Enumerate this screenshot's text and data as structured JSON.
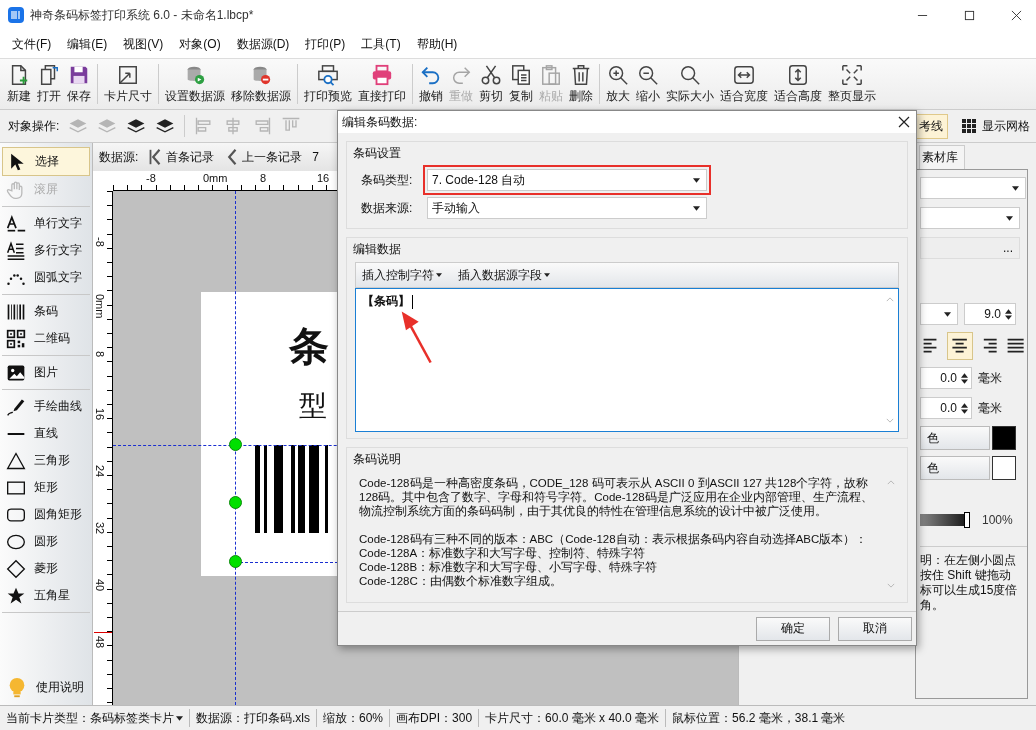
{
  "window": {
    "title": "神奇条码标签打印系统 6.0 - 未命名1.lbcp*"
  },
  "menu": [
    "文件(F)",
    "编辑(E)",
    "视图(V)",
    "对象(O)",
    "数据源(D)",
    "打印(P)",
    "工具(T)",
    "帮助(H)"
  ],
  "toolbar": {
    "groups": [
      [
        {
          "label": "新建",
          "disabled": false
        },
        {
          "label": "打开",
          "disabled": false
        },
        {
          "label": "保存",
          "disabled": false
        }
      ],
      [
        {
          "label": "卡片尺寸",
          "disabled": false
        }
      ],
      [
        {
          "label": "设置数据源",
          "disabled": false
        },
        {
          "label": "移除数据源",
          "disabled": false
        }
      ],
      [
        {
          "label": "打印预览",
          "disabled": false
        },
        {
          "label": "直接打印",
          "disabled": false
        }
      ],
      [
        {
          "label": "撤销",
          "disabled": false
        },
        {
          "label": "重做",
          "disabled": true
        },
        {
          "label": "剪切",
          "disabled": false
        },
        {
          "label": "复制",
          "disabled": false
        },
        {
          "label": "粘贴",
          "disabled": true
        },
        {
          "label": "删除",
          "disabled": false
        }
      ],
      [
        {
          "label": "放大",
          "disabled": false
        },
        {
          "label": "缩小",
          "disabled": false
        },
        {
          "label": "实际大小",
          "disabled": false
        },
        {
          "label": "适合宽度",
          "disabled": false
        },
        {
          "label": "适合高度",
          "disabled": false
        },
        {
          "label": "整页显示",
          "disabled": false
        }
      ]
    ]
  },
  "object_bar": {
    "label": "对象操作:",
    "layer_tools": [
      {
        "disabled": true
      },
      {
        "disabled": true
      },
      {
        "disabled": false
      },
      {
        "disabled": false
      }
    ],
    "align_tools": [
      {
        "disabled": true
      },
      {
        "disabled": true
      },
      {
        "disabled": true
      },
      {
        "disabled": true
      }
    ],
    "guides_toggle": {
      "label": "考线",
      "on": true
    },
    "grid_toggle": {
      "label": "显示网格"
    }
  },
  "tools": {
    "groups": [
      [
        {
          "label": "选择",
          "selected": true,
          "disabled": false
        },
        {
          "label": "滚屏",
          "selected": false,
          "disabled": true
        }
      ],
      [
        {
          "label": "单行文字",
          "selected": false,
          "disabled": false
        },
        {
          "label": "多行文字",
          "selected": false,
          "disabled": false
        },
        {
          "label": "圆弧文字",
          "selected": false,
          "disabled": false
        }
      ],
      [
        {
          "label": "条码",
          "selected": false,
          "disabled": false
        },
        {
          "label": "二维码",
          "selected": false,
          "disabled": false
        }
      ],
      [
        {
          "label": "图片",
          "selected": false,
          "disabled": false
        }
      ],
      [
        {
          "label": "手绘曲线",
          "selected": false,
          "disabled": false
        },
        {
          "label": "直线",
          "selected": false,
          "disabled": false
        },
        {
          "label": "三角形",
          "selected": false,
          "disabled": false
        },
        {
          "label": "矩形",
          "selected": false,
          "disabled": false
        },
        {
          "label": "圆角矩形",
          "selected": false,
          "disabled": false
        },
        {
          "label": "圆形",
          "selected": false,
          "disabled": false
        },
        {
          "label": "菱形",
          "selected": false,
          "disabled": false
        },
        {
          "label": "五角星",
          "selected": false,
          "disabled": false
        }
      ]
    ],
    "help": "使用说明"
  },
  "data_source_bar": {
    "label": "数据源:",
    "buttons": [
      "首条记录",
      "上一条记录"
    ],
    "record": "7"
  },
  "ruler": {
    "horizontal": [
      "-8",
      "0mm",
      "8",
      "16"
    ],
    "vertical": [
      "-8",
      "0mm",
      "8",
      "16",
      "24",
      "32",
      "40",
      "48"
    ]
  },
  "canvas": {
    "title_text": "条",
    "subtitle_text": "型"
  },
  "right_panel": {
    "tab": "素材库",
    "browse_button": "...",
    "font_size": "9.0",
    "align_buttons": [
      {
        "selected": false
      },
      {
        "selected": true
      },
      {
        "selected": false
      },
      {
        "selected": false
      }
    ],
    "offsets": [
      {
        "value": "0.0",
        "unit": "毫米"
      },
      {
        "value": "0.0",
        "unit": "毫米"
      }
    ],
    "color_buttons": [
      {
        "label": "色",
        "color": "#000000"
      },
      {
        "label": "色",
        "color": "#ffffff"
      }
    ],
    "opacity": {
      "level": 1,
      "reading": "100%"
    },
    "help_lines": [
      "明：在左侧小圆点",
      "按住 Shift 键拖动",
      "标可以生成15度倍",
      "角。"
    ]
  },
  "dialog": {
    "title": "编辑条码数据:",
    "settings": {
      "legend": "条码设置",
      "rows": [
        {
          "label": "条码类型:",
          "value": "7.  Code-128 自动",
          "highlighted": true
        },
        {
          "label": "数据来源:",
          "value": "手动输入",
          "highlighted": false
        }
      ]
    },
    "edit": {
      "legend": "编辑数据",
      "menus": [
        "插入控制字符",
        "插入数据源字段"
      ],
      "value": "【条码】"
    },
    "description": {
      "legend": "条码说明",
      "paragraphs": [
        "Code-128码是一种高密度条码，CODE_128 码可表示从 ASCII 0 到ASCII 127 共128个字符，故称128码。其中包含了数字、字母和符号字符。Code-128码是广泛应用在企业内部管理、生产流程、物流控制系统方面的条码码制，由于其优良的特性在管理信息系统的设计中被广泛使用。"
      ],
      "lines": [
        "Code-128码有三种不同的版本：ABC（Code-128自动：表示根据条码内容自动选择ABC版本）：",
        "Code-128A：标准数字和大写字母、控制符、特殊字符",
        "Code-128B：标准数字和大写字母、小写字母、特殊字符",
        "Code-128C：由偶数个标准数字组成。"
      ]
    },
    "buttons": [
      "确定",
      "取消"
    ]
  },
  "status_bar": [
    {
      "text": "当前卡片类型：条码标签类卡片",
      "dropdown": true
    },
    {
      "text": "数据源：打印条码.xls",
      "dropdown": false
    },
    {
      "text": "缩放：60%",
      "dropdown": false
    },
    {
      "text": "画布DPI：300",
      "dropdown": false
    },
    {
      "text": "卡片尺寸：60.0 毫米 x 40.0 毫米",
      "dropdown": false
    },
    {
      "text": "鼠标位置：56.2 毫米，38.1 毫米",
      "dropdown": false
    }
  ]
}
